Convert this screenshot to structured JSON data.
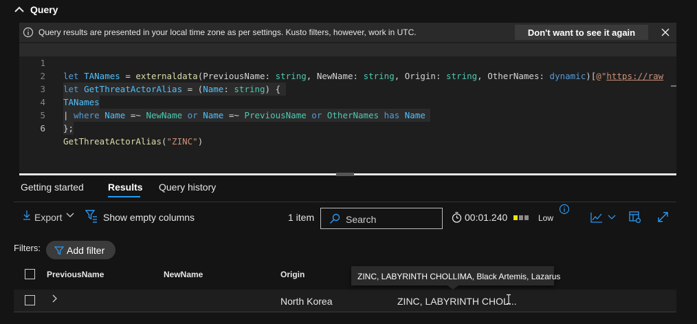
{
  "header": {
    "title": "Query",
    "collapse_icon": "chevron-up-icon"
  },
  "info_bar": {
    "icon": "info-icon",
    "message": "Query results are presented in your local time zone as per settings. Kusto filters, however, work in UTC.",
    "dismiss_label": "Don't want to see it again",
    "close_icon": "close-icon"
  },
  "editor": {
    "line_numbers": [
      "1",
      "2",
      "3",
      "4",
      "5",
      "6"
    ],
    "line1": [
      "let ",
      "TANames",
      " = ",
      "externaldata",
      "(",
      "PreviousName",
      ": ",
      "string",
      ", ",
      "NewName",
      ": ",
      "string",
      ", ",
      "Origin",
      ": ",
      "string",
      ", ",
      "OtherNames",
      ": ",
      "dynamic",
      ")[",
      "@\"",
      "https://raw"
    ],
    "line2": [
      "let ",
      "GetThreatActorAlias",
      " = (",
      "Name",
      ": ",
      "string",
      ") {"
    ],
    "line3": [
      "TANames"
    ],
    "line4": [
      "| ",
      "where ",
      "Name",
      " =~ ",
      "NewName",
      " or ",
      "Name",
      " =~ ",
      "PreviousName",
      " or ",
      "OtherNames",
      " has ",
      "Name"
    ],
    "line5": [
      "};"
    ],
    "line6": [
      "GetThreatActorAlias",
      "(",
      "\"ZINC\"",
      ")"
    ]
  },
  "tabs": [
    {
      "label": "Getting started",
      "active": false
    },
    {
      "label": "Results",
      "active": true
    },
    {
      "label": "Query history",
      "active": false
    }
  ],
  "toolbar": {
    "export_label": "Export",
    "show_empty_label": "Show empty columns",
    "item_count": "1 item",
    "search_placeholder": "Search",
    "duration": "00:01.240",
    "perf_label": "Low",
    "perf_colors": [
      "#f2e600",
      "#8a8a8a",
      "#8a8a8a"
    ]
  },
  "filters": {
    "label": "Filters:",
    "add_filter_label": "Add filter"
  },
  "table": {
    "columns": [
      "PreviousName",
      "NewName",
      "Origin"
    ],
    "rows": [
      {
        "PreviousName": "",
        "NewName": "",
        "Origin": "North Korea",
        "OtherNames": "ZINC, LABYRINTH CHOL..."
      }
    ]
  },
  "tooltip": {
    "text": "ZINC, LABYRINTH CHOLLIMA, Black Artemis, Lazarus"
  },
  "colors": {
    "accent": "#2899f5",
    "background": "#141414",
    "panel": "#1e1e1e"
  }
}
